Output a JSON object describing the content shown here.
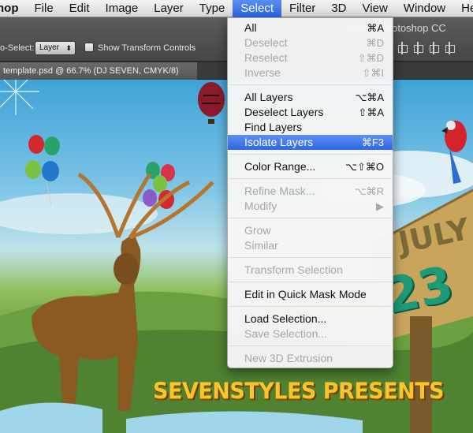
{
  "menubar": {
    "items": [
      "hop",
      "File",
      "Edit",
      "Image",
      "Layer",
      "Type",
      "Select",
      "Filter",
      "3D",
      "View",
      "Window",
      "Help"
    ],
    "active_index": 6
  },
  "options_bar": {
    "app_title": "Adobe Photoshop CC",
    "auto_select_label": "o-Select:",
    "auto_select_value": "Layer",
    "transform_controls_label": "Show Transform Controls"
  },
  "document": {
    "tab_title": "template.psd @ 66.7% (DJ SEVEN, CMYK/8)"
  },
  "artwork": {
    "headline": "SEVENSTYLES PRESENTS",
    "sign_month": "JULY",
    "sign_day": "23"
  },
  "select_menu": {
    "items": [
      {
        "label": "All",
        "shortcut": "⌘A",
        "disabled": false
      },
      {
        "label": "Deselect",
        "shortcut": "⌘D",
        "disabled": true
      },
      {
        "label": "Reselect",
        "shortcut": "⇧⌘D",
        "disabled": true
      },
      {
        "label": "Inverse",
        "shortcut": "⇧⌘I",
        "disabled": true
      },
      {
        "separator": true
      },
      {
        "label": "All Layers",
        "shortcut": "⌥⌘A",
        "disabled": false
      },
      {
        "label": "Deselect Layers",
        "shortcut": "⇧⌘A",
        "disabled": false
      },
      {
        "label": "Find Layers",
        "shortcut": "",
        "disabled": false
      },
      {
        "label": "Isolate Layers",
        "shortcut": "⌘F3",
        "disabled": false,
        "highlighted": true
      },
      {
        "separator": true
      },
      {
        "label": "Color Range...",
        "shortcut": "⌥⇧⌘O",
        "disabled": false
      },
      {
        "separator": true
      },
      {
        "label": "Refine Mask...",
        "shortcut": "⌥⌘R",
        "disabled": true
      },
      {
        "label": "Modify",
        "shortcut": "▶",
        "disabled": true
      },
      {
        "separator": true
      },
      {
        "label": "Grow",
        "shortcut": "",
        "disabled": true
      },
      {
        "label": "Similar",
        "shortcut": "",
        "disabled": true
      },
      {
        "separator": true
      },
      {
        "label": "Transform Selection",
        "shortcut": "",
        "disabled": true
      },
      {
        "separator": true
      },
      {
        "label": "Edit in Quick Mask Mode",
        "shortcut": "",
        "disabled": false
      },
      {
        "separator": true
      },
      {
        "label": "Load Selection...",
        "shortcut": "",
        "disabled": false
      },
      {
        "label": "Save Selection...",
        "shortcut": "",
        "disabled": true
      },
      {
        "separator": true
      },
      {
        "label": "New 3D Extrusion",
        "shortcut": "",
        "disabled": true
      }
    ]
  },
  "colors": {
    "menu_highlight": "#3a72ea",
    "headline_yellow": "#f8c62b",
    "sign_green": "#1f9a76"
  }
}
